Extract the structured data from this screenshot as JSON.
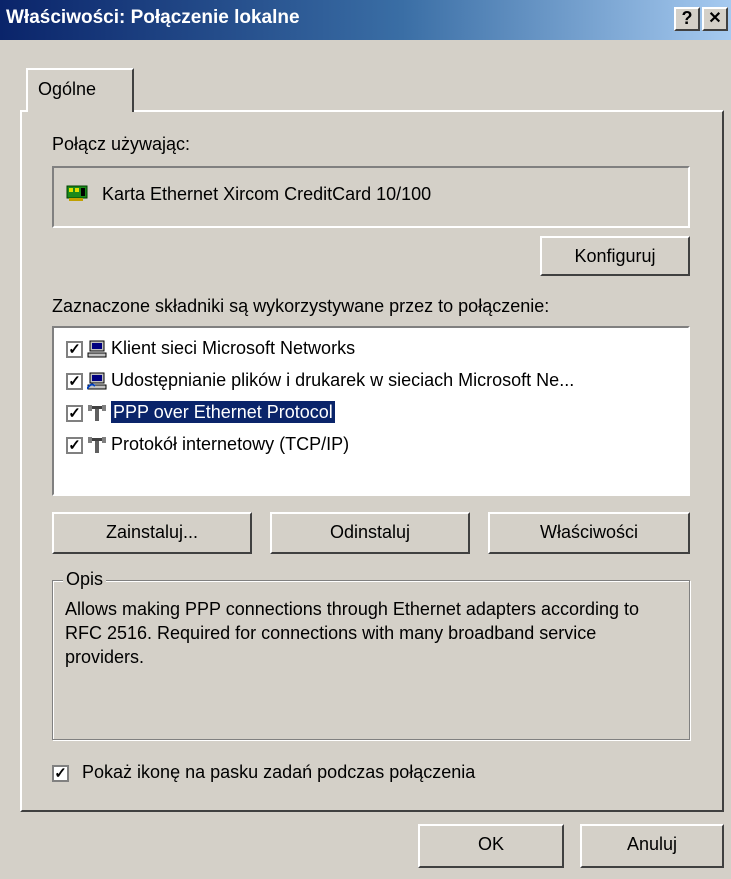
{
  "window": {
    "title": "Właściwości: Połączenie lokalne",
    "help_button": "?",
    "close_button": "✕"
  },
  "tabs": [
    {
      "label": "Ogólne",
      "active": true
    }
  ],
  "connect_using": {
    "label": "Połącz używając:",
    "adapter": "Karta Ethernet Xircom CreditCard 10/100",
    "icon": "network-card-icon",
    "configure_button": "Konfiguruj"
  },
  "components": {
    "label": "Zaznaczone składniki są wykorzystywane przez to połączenie:",
    "items": [
      {
        "label": "Klient sieci Microsoft Networks",
        "checked": true,
        "icon": "computer-icon",
        "selected": false
      },
      {
        "label": "Udostępnianie plików i drukarek w sieciach Microsoft Ne...",
        "checked": true,
        "icon": "computer-share-icon",
        "selected": false
      },
      {
        "label": "PPP over Ethernet Protocol",
        "checked": true,
        "icon": "protocol-icon",
        "selected": true
      },
      {
        "label": "Protokół internetowy (TCP/IP)",
        "checked": true,
        "icon": "protocol-icon",
        "selected": false
      }
    ]
  },
  "actions": {
    "install": "Zainstaluj...",
    "uninstall": "Odinstaluj",
    "properties": "Właściwości"
  },
  "description": {
    "legend": "Opis",
    "text": "Allows making PPP connections through Ethernet adapters according to RFC 2516. Required for connections with many broadband service providers."
  },
  "show_icon": {
    "label": "Pokaż ikonę na pasku zadań podczas połączenia",
    "checked": true
  },
  "footer": {
    "ok": "OK",
    "cancel": "Anuluj"
  },
  "colors": {
    "face": "#d4d0c8",
    "title_active": "#0a246a",
    "selection": "#0a246a"
  }
}
